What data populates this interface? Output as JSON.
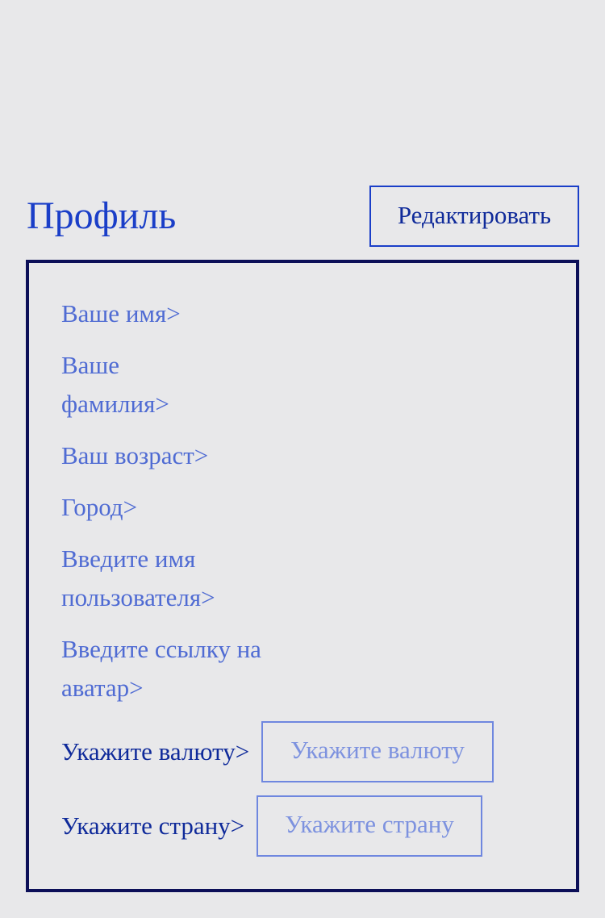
{
  "header": {
    "title": "Профиль",
    "edit_label": "Редактировать"
  },
  "profile": {
    "fields": [
      {
        "line1": "Ваше имя>"
      },
      {
        "line1": "Ваше",
        "line2": "фамилия>"
      },
      {
        "line1": "Ваш возраст>"
      },
      {
        "line1": "Город>"
      },
      {
        "line1": "Введите имя",
        "line2": "пользователя>"
      },
      {
        "line1": "Введите ссылку на",
        "line2": "аватар>"
      }
    ],
    "currency": {
      "label": "Укажите валюту>",
      "placeholder": "Укажите валюту"
    },
    "country": {
      "label": "Укажите страну>",
      "placeholder": "Укажите страну"
    }
  },
  "colors": {
    "background": "#e8e8ea",
    "accent": "#1a3ec8",
    "panel_border": "#0c0f58",
    "field_text": "#4f6bd3",
    "placeholder_text": "#7d92df"
  }
}
